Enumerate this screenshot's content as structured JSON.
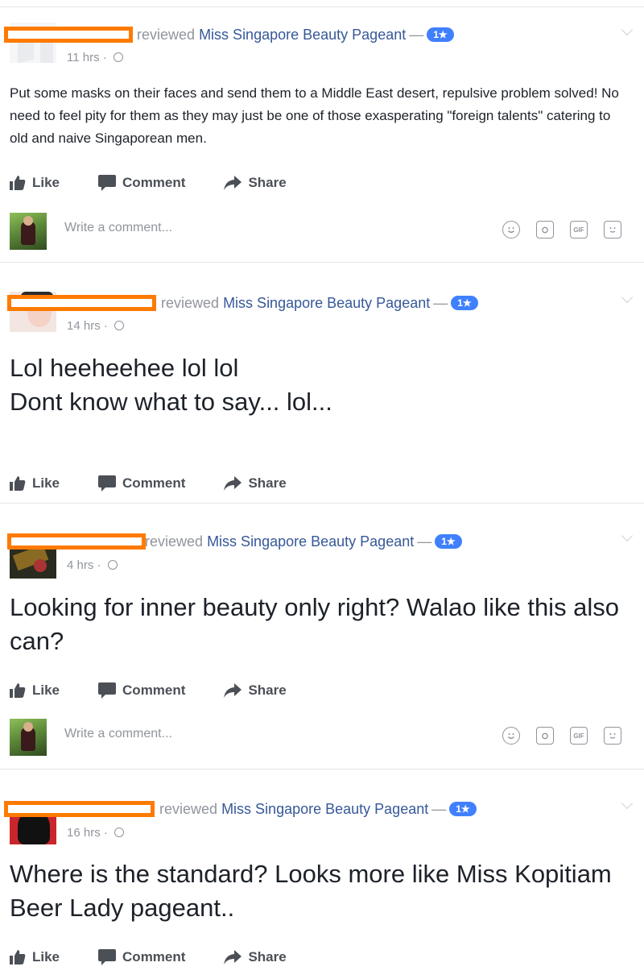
{
  "posts": [
    {
      "action_text": "reviewed",
      "page_name": "Miss Singapore Beauty Pageant",
      "dash": "—",
      "rating": "1★",
      "time": "11 hrs",
      "separator": "·",
      "body": "Put some masks on their faces and send them to a Middle East desert, repulsive problem solved! No need to feel pity for them as they may just be one of those exasperating \"foreign talents\" catering to old and naive Singaporean men.",
      "like_label": "Like",
      "comment_label": "Comment",
      "share_label": "Share",
      "comment_placeholder": "Write a comment..."
    },
    {
      "action_text": "reviewed",
      "page_name": "Miss Singapore Beauty Pageant",
      "dash": "—",
      "rating": "1★",
      "time": "14 hrs",
      "separator": "·",
      "body_line1": "Lol heeheehee lol lol",
      "body_line2": "Dont know what to say... lol...",
      "like_label": "Like",
      "comment_label": "Comment",
      "share_label": "Share"
    },
    {
      "action_text": "reviewed",
      "page_name": "Miss Singapore Beauty Pageant",
      "dash": "—",
      "rating": "1★",
      "time": "4 hrs",
      "separator": "·",
      "body": "Looking for inner beauty only right? Walao like this also can?",
      "like_label": "Like",
      "comment_label": "Comment",
      "share_label": "Share",
      "comment_placeholder": "Write a comment..."
    },
    {
      "action_text": "reviewed",
      "page_name": "Miss Singapore Beauty Pageant",
      "dash": "—",
      "rating": "1★",
      "time": "16 hrs",
      "separator": "·",
      "body": "Where is the standard? Looks more like Miss Kopitiam Beer Lady pageant..",
      "like_label": "Like",
      "comment_label": "Comment",
      "share_label": "Share"
    }
  ],
  "comment_icons": [
    "emoji-icon",
    "camera-icon",
    "gif-icon",
    "sticker-icon"
  ],
  "gif_text": "GIF",
  "colors": {
    "redaction": "#ff7a00",
    "link": "#365899",
    "badge": "#4080ff",
    "meta": "#90949c",
    "action": "#4b4f56"
  }
}
